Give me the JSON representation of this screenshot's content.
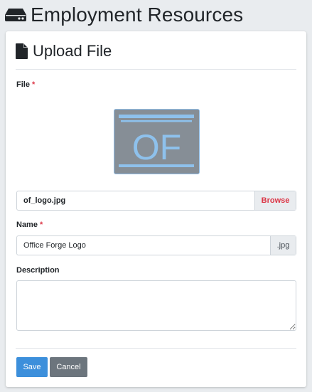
{
  "header": {
    "icon": "hdd-icon",
    "title": "Employment Resources"
  },
  "card": {
    "icon": "file-icon",
    "title": "Upload File"
  },
  "form": {
    "file": {
      "label": "File",
      "required_marker": "*",
      "preview_image_text": "OF",
      "filename": "of_logo.jpg",
      "browse_label": "Browse"
    },
    "name": {
      "label": "Name",
      "required_marker": "*",
      "value": "Office Forge Logo",
      "extension": ".jpg"
    },
    "description": {
      "label": "Description",
      "value": ""
    }
  },
  "actions": {
    "save_label": "Save",
    "cancel_label": "Cancel"
  },
  "colors": {
    "page_bg": "#e9ecef",
    "primary": "#3c8fdb",
    "secondary": "#6c757d",
    "required": "#dc3545",
    "logo_blue": "#8ec1ec",
    "logo_bg": "#868e96"
  }
}
